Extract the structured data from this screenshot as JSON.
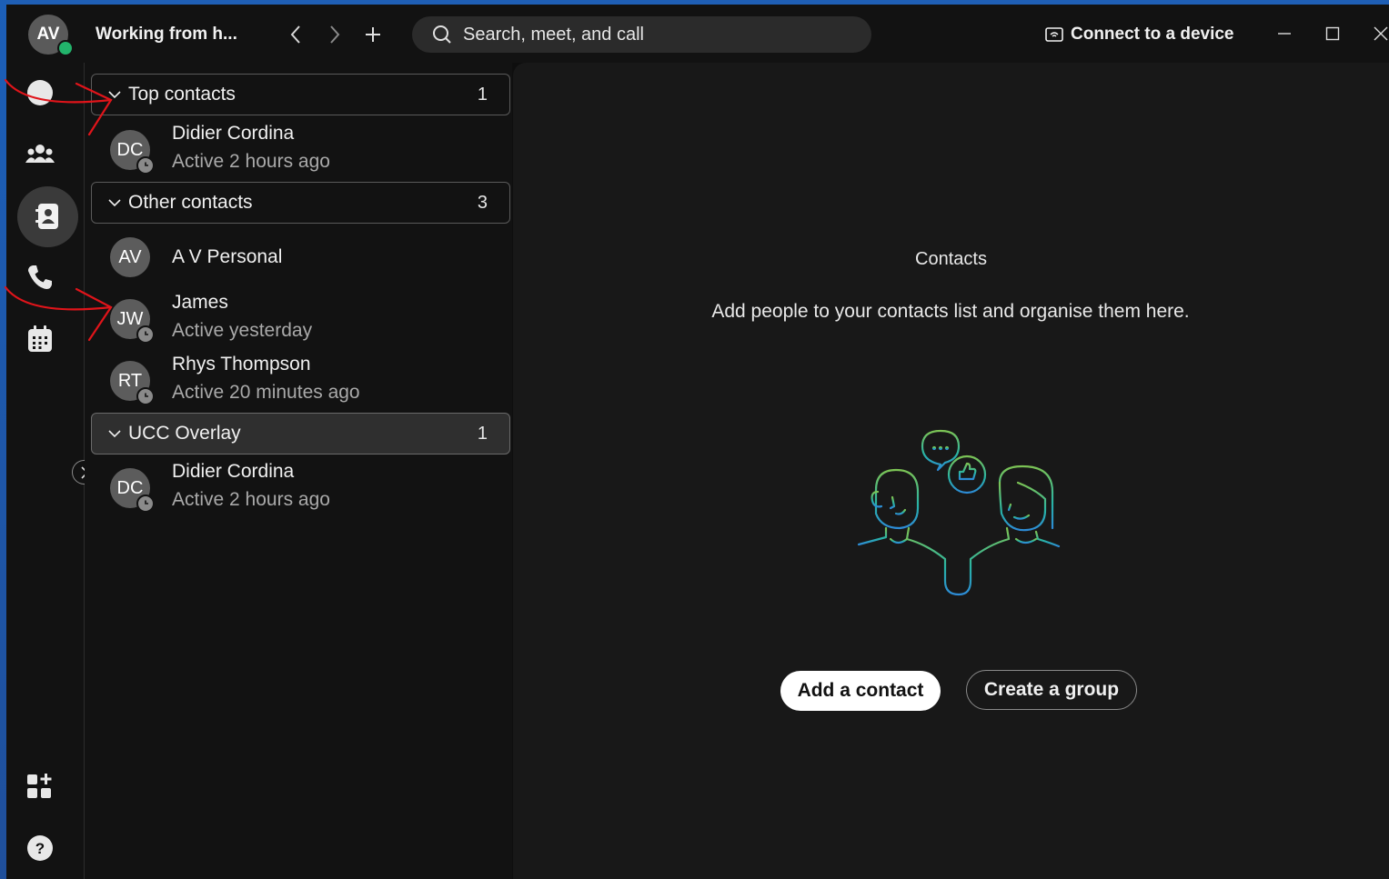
{
  "user": {
    "initials": "AV"
  },
  "header": {
    "status_title": "Working from h...",
    "search_placeholder": "Search, meet, and call",
    "connect_label": "Connect to a device"
  },
  "groups": [
    {
      "label": "Top contacts",
      "count": "1"
    },
    {
      "label": "Other contacts",
      "count": "3"
    },
    {
      "label": "UCC Overlay",
      "count": "1"
    }
  ],
  "contacts": [
    {
      "initials": "DC",
      "name": "Didier Cordina",
      "status": "Active 2 hours ago"
    },
    {
      "initials": "AV",
      "name": "A V Personal",
      "status": ""
    },
    {
      "initials": "JW",
      "name": "James",
      "status": "Active yesterday"
    },
    {
      "initials": "RT",
      "name": "Rhys Thompson",
      "status": "Active 20 minutes ago"
    },
    {
      "initials": "DC",
      "name": "Didier Cordina",
      "status": "Active 2 hours ago"
    }
  ],
  "main": {
    "title": "Contacts",
    "description": "Add people to your contacts list and organise them here.",
    "add_contact_label": "Add a contact",
    "create_group_label": "Create a group"
  },
  "colors": {
    "presence": "#22b36b",
    "annotation": "#e0141a",
    "illustration_green": "#7cc354",
    "illustration_teal": "#28b3a6",
    "illustration_blue": "#2d8bd6"
  }
}
